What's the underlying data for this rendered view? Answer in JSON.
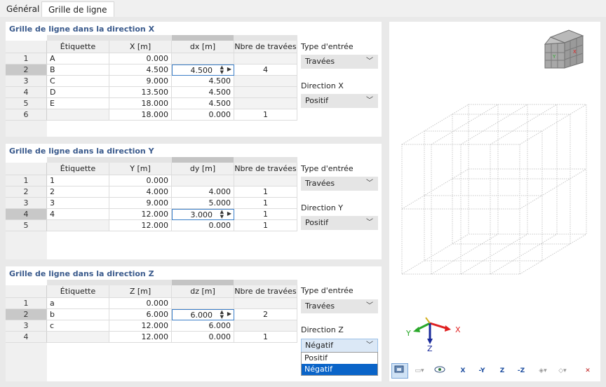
{
  "tabs": [
    {
      "label": "Général"
    },
    {
      "label": "Grille de ligne"
    }
  ],
  "columns_common": {
    "label": "Étiquette",
    "count": "Nbre de travées"
  },
  "entry_type_label": "Type d'entrée",
  "panels": {
    "x": {
      "title": "Grille de ligne dans la direction X",
      "coord_header": "X [m]",
      "delta_header": "dx [m]",
      "rows": [
        {
          "num": "1",
          "label": "A",
          "coord": "0.000",
          "delta": "",
          "count": ""
        },
        {
          "num": "2",
          "label": "B",
          "coord": "4.500",
          "delta": "4.500",
          "count": "4"
        },
        {
          "num": "3",
          "label": "C",
          "coord": "9.000",
          "delta": "4.500",
          "count": ""
        },
        {
          "num": "4",
          "label": "D",
          "coord": "13.500",
          "delta": "4.500",
          "count": ""
        },
        {
          "num": "5",
          "label": "E",
          "coord": "18.000",
          "delta": "4.500",
          "count": ""
        },
        {
          "num": "6",
          "label": "",
          "coord": "18.000",
          "delta": "0.000",
          "count": "1"
        }
      ],
      "entry_type_value": "Travées",
      "direction_label": "Direction X",
      "direction_value": "Positif"
    },
    "y": {
      "title": "Grille de ligne dans la direction Y",
      "coord_header": "Y [m]",
      "delta_header": "dy [m]",
      "rows": [
        {
          "num": "1",
          "label": "1",
          "coord": "0.000",
          "delta": "",
          "count": ""
        },
        {
          "num": "2",
          "label": "2",
          "coord": "4.000",
          "delta": "4.000",
          "count": "1"
        },
        {
          "num": "3",
          "label": "3",
          "coord": "9.000",
          "delta": "5.000",
          "count": "1"
        },
        {
          "num": "4",
          "label": "4",
          "coord": "12.000",
          "delta": "3.000",
          "count": "1"
        },
        {
          "num": "5",
          "label": "",
          "coord": "12.000",
          "delta": "0.000",
          "count": "1"
        }
      ],
      "entry_type_value": "Travées",
      "direction_label": "Direction Y",
      "direction_value": "Positif"
    },
    "z": {
      "title": "Grille de ligne dans la direction Z",
      "coord_header": "Z [m]",
      "delta_header": "dz [m]",
      "rows": [
        {
          "num": "1",
          "label": "a",
          "coord": "0.000",
          "delta": "",
          "count": ""
        },
        {
          "num": "2",
          "label": "b",
          "coord": "6.000",
          "delta": "6.000",
          "count": "2"
        },
        {
          "num": "3",
          "label": "c",
          "coord": "12.000",
          "delta": "6.000",
          "count": ""
        },
        {
          "num": "4",
          "label": "",
          "coord": "12.000",
          "delta": "0.000",
          "count": "1"
        }
      ],
      "entry_type_value": "Travées",
      "direction_label": "Direction Z",
      "direction_value": "Négatif",
      "direction_options": [
        "Positif",
        "Négatif"
      ]
    }
  },
  "view": {
    "axis_x": "X",
    "axis_y": "Y",
    "axis_z": "Z",
    "colors": {
      "x": "#e02020",
      "y": "#2aa82a",
      "z": "#1a2a9a",
      "grid": "#c8c8c8"
    }
  },
  "toolbar": {
    "buttons": [
      {
        "icon": "display-options-icon"
      },
      {
        "icon": "render-mode-icon"
      },
      {
        "icon": "visibility-icon"
      },
      {
        "label": "X"
      },
      {
        "label": "-Y"
      },
      {
        "label": "Z"
      },
      {
        "label": "-Z"
      },
      {
        "icon": "iso-view-icon"
      },
      {
        "icon": "perspective-icon"
      },
      {
        "icon": "reset-view-icon"
      }
    ]
  }
}
